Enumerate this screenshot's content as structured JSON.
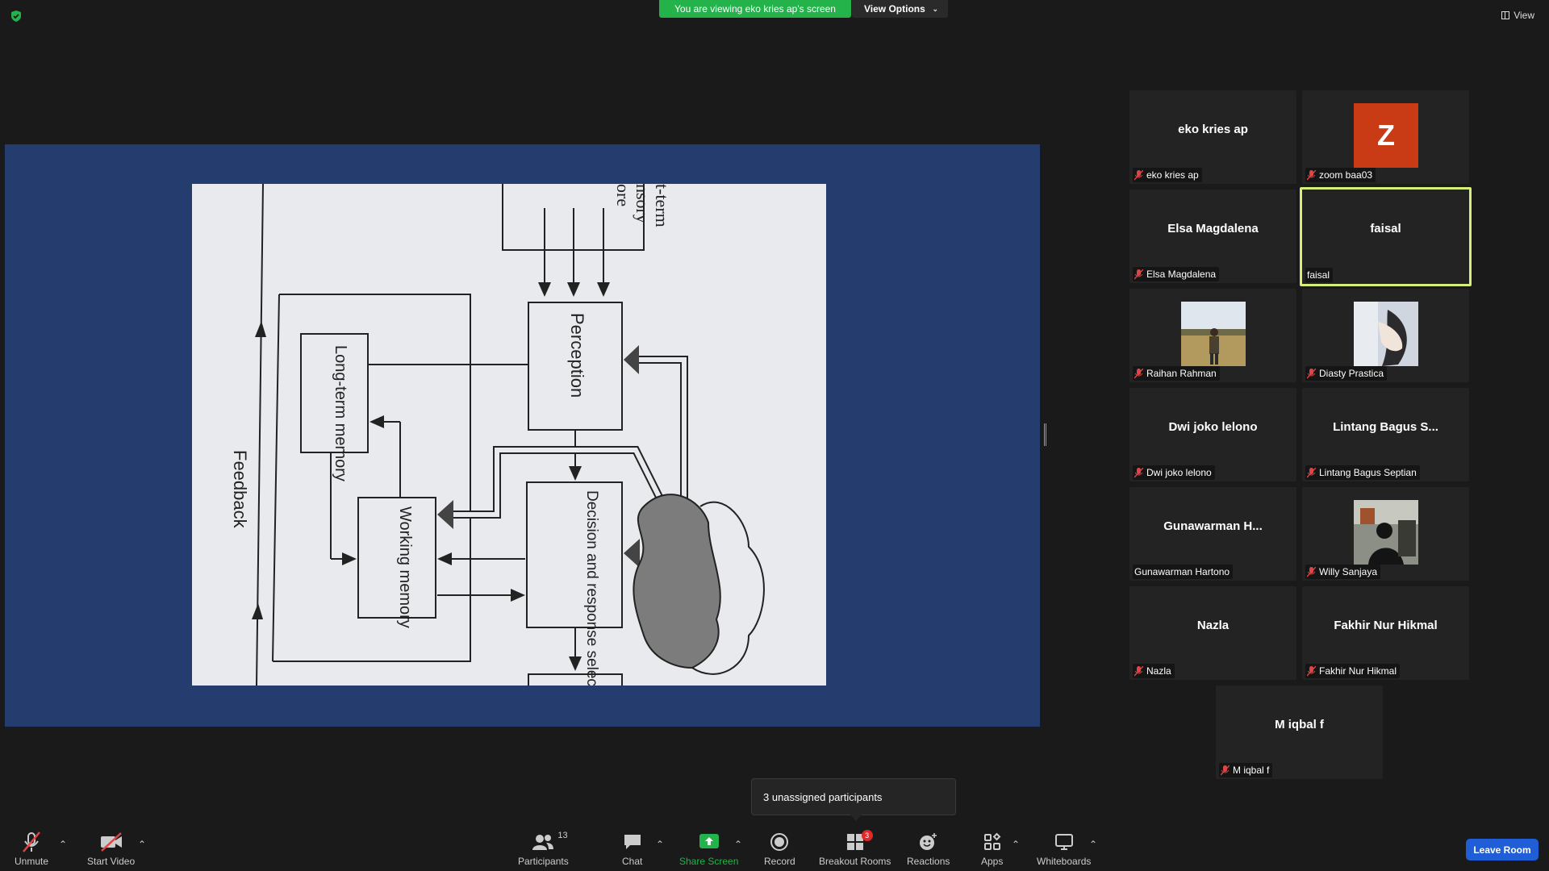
{
  "banner": {
    "viewing_text": "You are viewing eko kries ap's screen",
    "view_options_label": "View Options",
    "view_label": "View",
    "accent": "#23b34a"
  },
  "diagram": {
    "boxes": [
      "Perception",
      "Long-term memory",
      "Working memory",
      "Decision and response selection"
    ],
    "edge_text": [
      "t-term",
      "nsory",
      "ore"
    ],
    "feedback_label": "Feedback"
  },
  "participants": [
    {
      "display": "eko kries ap",
      "label": "eko kries ap",
      "muted": true,
      "avatar": "none"
    },
    {
      "display": "",
      "label": "zoom baa03",
      "muted": true,
      "avatar": "letter",
      "letter": "Z"
    },
    {
      "display": "Elsa Magdalena",
      "label": "Elsa Magdalena",
      "muted": true,
      "avatar": "none"
    },
    {
      "display": "faisal",
      "label": "faisal",
      "muted": false,
      "avatar": "none",
      "active_speaker": true
    },
    {
      "display": "",
      "label": "Raihan Rahman",
      "muted": true,
      "avatar": "photo-field"
    },
    {
      "display": "",
      "label": "Diasty Prastica",
      "muted": true,
      "avatar": "photo-pregnant"
    },
    {
      "display": "Dwi joko lelono",
      "label": "Dwi joko lelono",
      "muted": true,
      "avatar": "none"
    },
    {
      "display": "Lintang Bagus S...",
      "label": "Lintang Bagus Septian",
      "muted": true,
      "avatar": "none"
    },
    {
      "display": "Gunawarman H...",
      "label": "Gunawarman Hartono",
      "muted": false,
      "avatar": "none"
    },
    {
      "display": "",
      "label": "Willy Sanjaya",
      "muted": true,
      "avatar": "photo-dark"
    },
    {
      "display": "Nazla",
      "label": "Nazla",
      "muted": true,
      "avatar": "none"
    },
    {
      "display": "Fakhir Nur Hikmal",
      "label": "Fakhir Nur Hikmal",
      "muted": true,
      "avatar": "none"
    },
    {
      "display": "M iqbal f",
      "label": "M iqbal f",
      "muted": true,
      "avatar": "none"
    }
  ],
  "toast": {
    "text": "3 unassigned participants"
  },
  "toolbar": {
    "unmute": "Unmute",
    "start_video": "Start Video",
    "participants": "Participants",
    "participants_count": "13",
    "chat": "Chat",
    "share_screen": "Share Screen",
    "record": "Record",
    "breakout_rooms": "Breakout Rooms",
    "breakout_badge": "3",
    "reactions": "Reactions",
    "apps": "Apps",
    "whiteboards": "Whiteboards",
    "leave_room": "Leave Room"
  },
  "colors": {
    "share_green": "#23b34a",
    "leave_blue": "#1f5ed6",
    "active_border": "#d6ee7a",
    "share_bg": "#243d6e"
  }
}
